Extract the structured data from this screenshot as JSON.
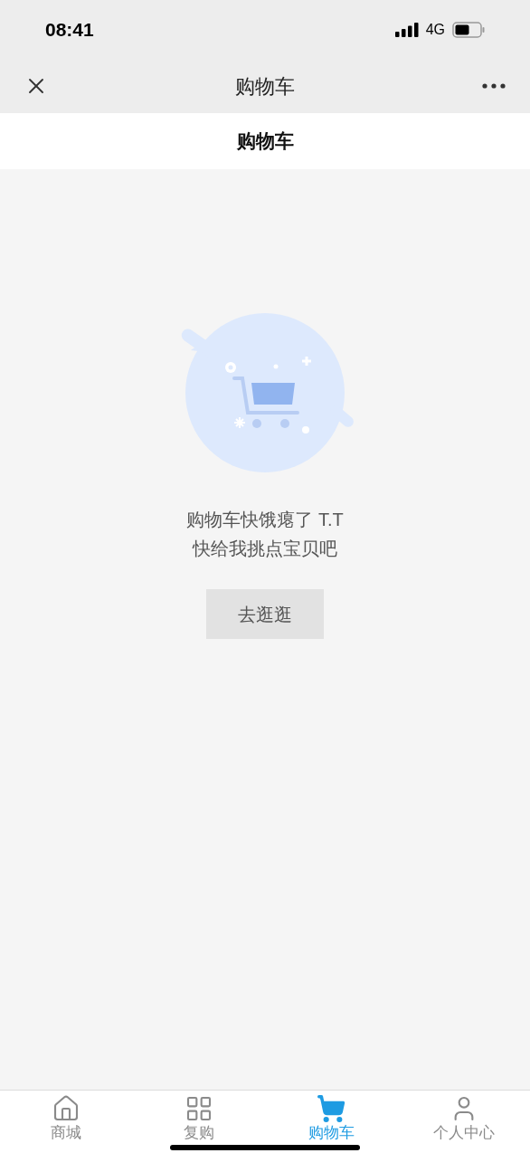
{
  "status_bar": {
    "time": "08:41",
    "network": "4G"
  },
  "nav_bar": {
    "title": "购物车"
  },
  "page_header": {
    "title": "购物车"
  },
  "empty_state": {
    "lines": [
      "购物车快饿瘪了 T.T",
      "快给我挑点宝贝吧"
    ],
    "button": "去逛逛"
  },
  "tab_bar": [
    {
      "kind": "home",
      "label": "商城",
      "selected": false
    },
    {
      "kind": "grid",
      "label": "复购",
      "selected": false
    },
    {
      "kind": "cart",
      "label": "购物车",
      "selected": true
    },
    {
      "kind": "user",
      "label": "个人中心",
      "selected": false
    }
  ]
}
